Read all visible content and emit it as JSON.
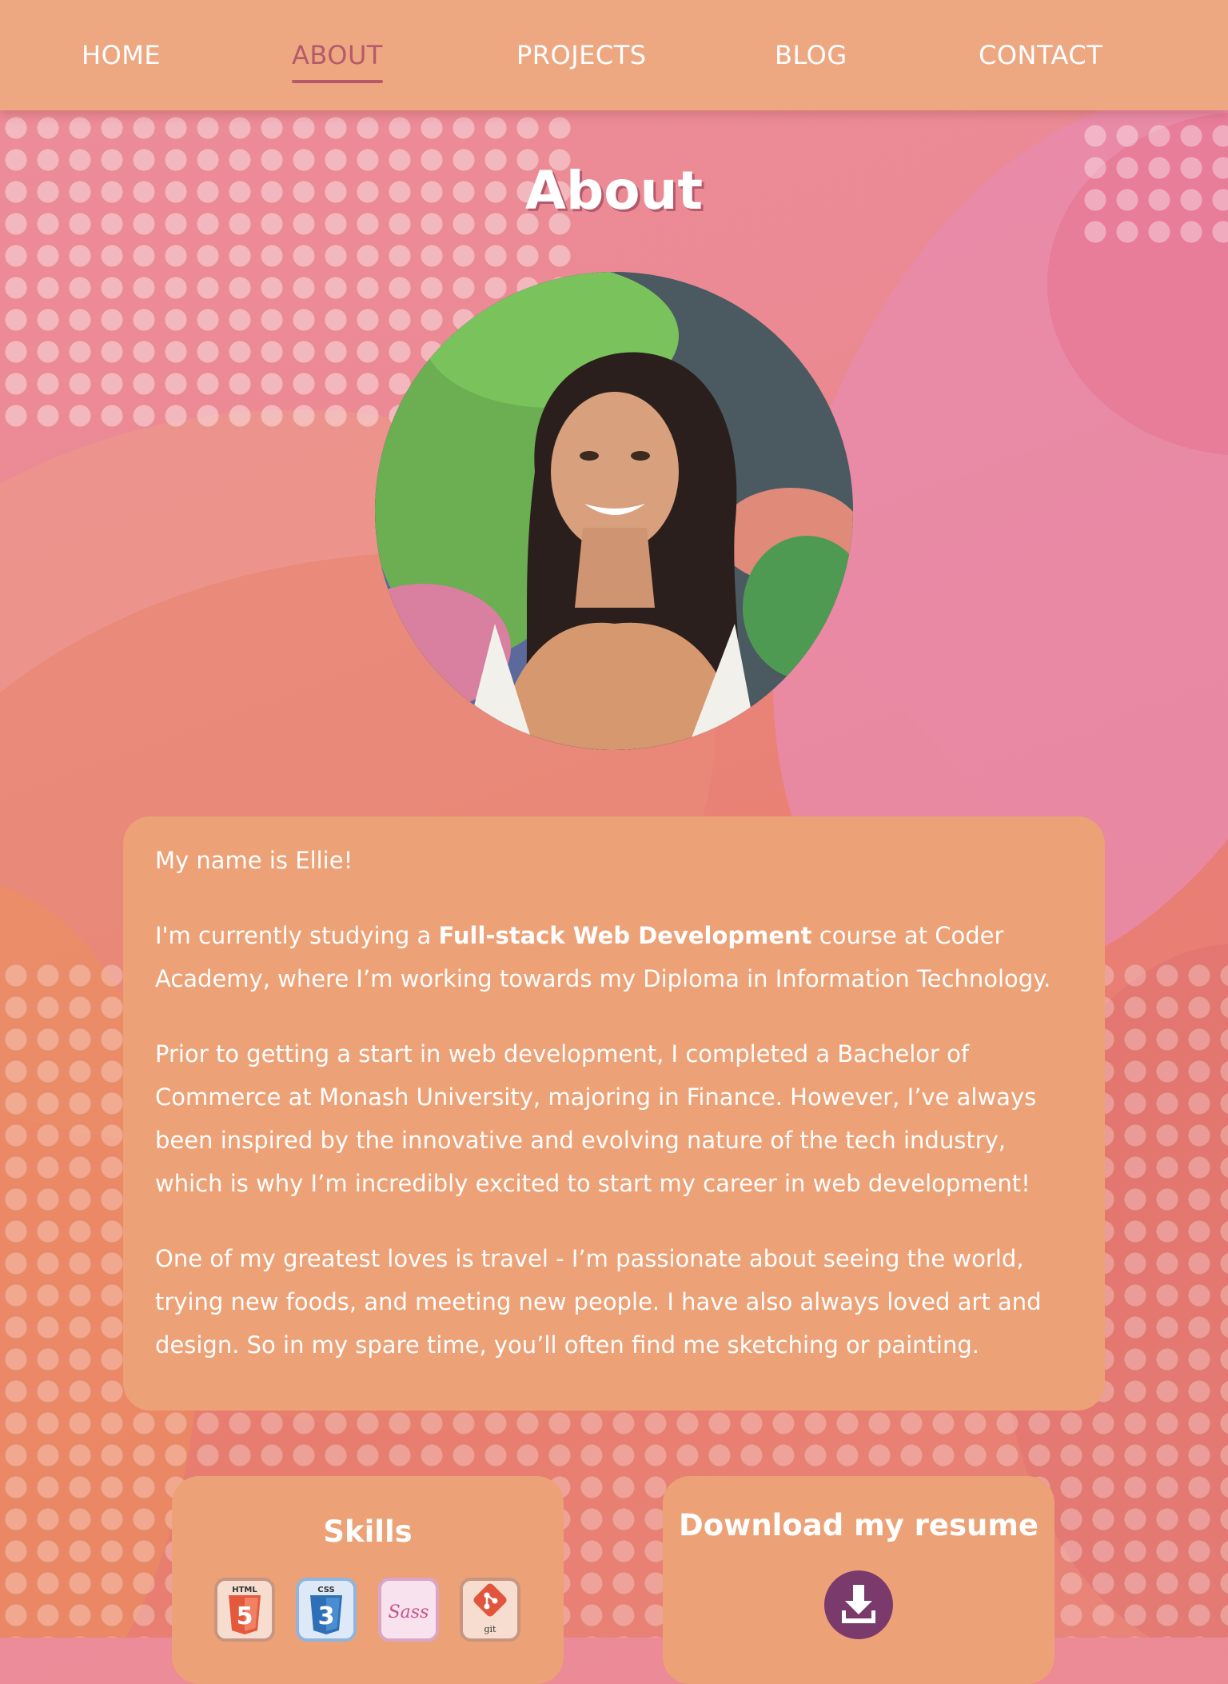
{
  "nav": {
    "items": [
      {
        "label": "HOME"
      },
      {
        "label": "ABOUT",
        "active": true
      },
      {
        "label": "PROJECTS"
      },
      {
        "label": "BLOG"
      },
      {
        "label": "CONTACT"
      }
    ]
  },
  "page": {
    "title": "About"
  },
  "bio": {
    "intro": "My name is Ellie!",
    "p2_before": "I'm currently studying a ",
    "p2_bold": "Full-stack Web Development",
    "p2_after": " course at Coder Academy, where I’m working towards my Diploma in Information Technology.",
    "p3": "Prior to getting a start in web development, I completed a Bachelor of Commerce at Monash University, majoring in Finance. However, I’ve always been inspired by the innovative and evolving nature of the tech industry, which is why I’m incredibly excited to start my career in web development!",
    "p4": "One of my greatest loves is travel - I’m passionate about seeing the world, trying new foods, and meeting new people. I have also always loved art and design. So in my spare time, you’ll often find me sketching or painting."
  },
  "skills": {
    "title": "Skills",
    "items": [
      {
        "icon": "html5-icon",
        "label": "HTML"
      },
      {
        "icon": "css3-icon",
        "label": "CSS"
      },
      {
        "icon": "sass-icon",
        "label": "Sass"
      },
      {
        "icon": "git-icon",
        "label": "git"
      }
    ]
  },
  "resume": {
    "title": "Download my resume",
    "button_icon": "download-icon"
  },
  "colors": {
    "nav_bg": "#eda882",
    "accent": "#b55a6a",
    "card_bg": "#eda176",
    "download_button": "#7a3a6c"
  }
}
